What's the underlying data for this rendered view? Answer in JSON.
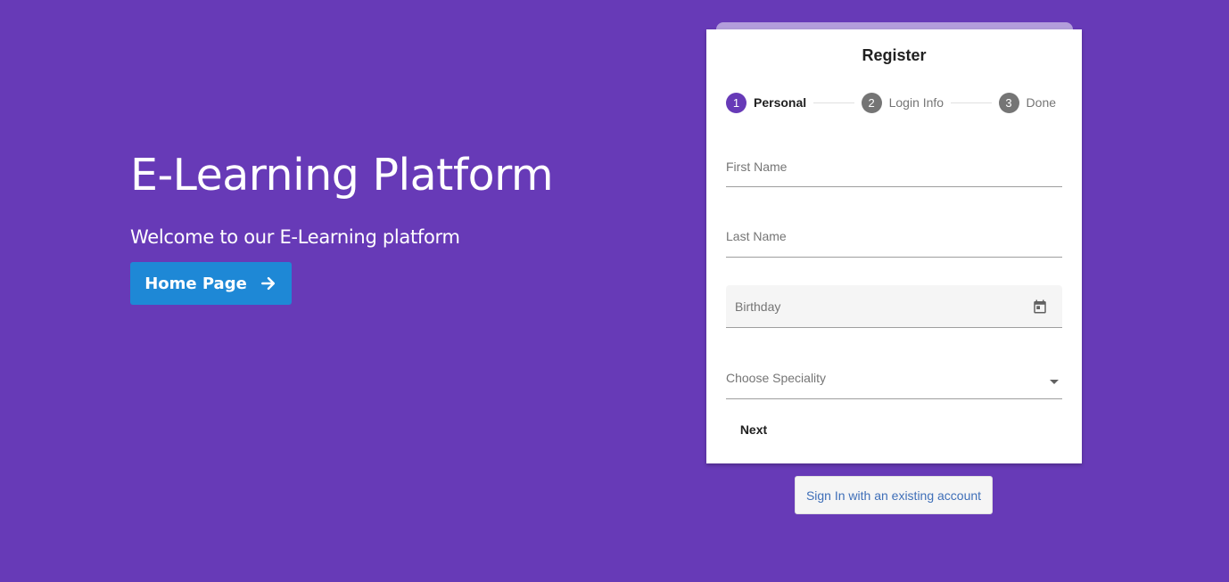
{
  "hero": {
    "title": "E-Learning Platform",
    "subtitle": "Welcome to our E-Learning platform",
    "home_button_label": "Home Page",
    "home_button_icon": "arrow-right-icon"
  },
  "register": {
    "title": "Register",
    "steps": [
      {
        "number": "1",
        "label": "Personal",
        "active": true
      },
      {
        "number": "2",
        "label": "Login Info",
        "active": false
      },
      {
        "number": "3",
        "label": "Done",
        "active": false
      }
    ],
    "fields": {
      "first_name_label": "First Name",
      "last_name_label": "Last Name",
      "birthday_label": "Birthday",
      "speciality_label": "Choose Speciality"
    },
    "next_label": "Next",
    "signin_label": "Sign In with an existing account"
  },
  "colors": {
    "background": "#673ab7",
    "accent_button": "#1e88d6",
    "active_step": "#673ab7",
    "inactive_step": "#757575",
    "link_text": "#3f6fb8"
  }
}
